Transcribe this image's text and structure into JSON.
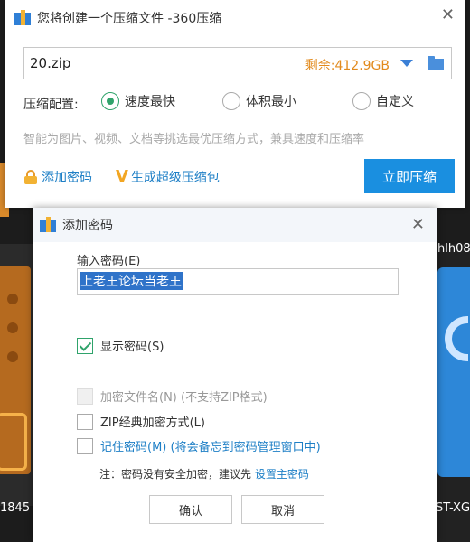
{
  "main_window": {
    "title": "您将创建一个压缩文件 -360压缩",
    "path_value": "20.zip",
    "free_space": "剩余:412.9GB",
    "config_label": "压缩配置:",
    "options": [
      "速度最快",
      "体积最小",
      "自定义"
    ],
    "selected_option": "速度最快",
    "hint": "智能为图片、视频、文档等挑选最优压缩方式，兼具速度和压缩率",
    "add_password_label": "添加密码",
    "super_pack_label": "生成超级压缩包",
    "compress_button": "立即压缩"
  },
  "password_dialog": {
    "title": "添加密码",
    "input_label": "输入密码(E)",
    "password_value": "上老王论坛当老王",
    "show_password": "显示密码(S)",
    "encrypt_filenames": "加密文件名(N) (不支持ZIP格式)",
    "zip_classic": "ZIP经典加密方式(L)",
    "remember_password": "记住密码(M) (将会备忘到密码管理窗口中)",
    "note_text": "注：密码没有安全加密，建议先 ",
    "note_link": "设置主密码",
    "ok_button": "确认",
    "cancel_button": "取消"
  },
  "background": {
    "left_text": "1845",
    "right_top_text": "hlh08",
    "right_bottom_text": "ST-XG"
  },
  "colors": {
    "accent_blue": "#1a8fe0",
    "link_blue": "#1e7fc6",
    "warning_orange": "#e28a1c",
    "check_green": "#2fa36b"
  }
}
